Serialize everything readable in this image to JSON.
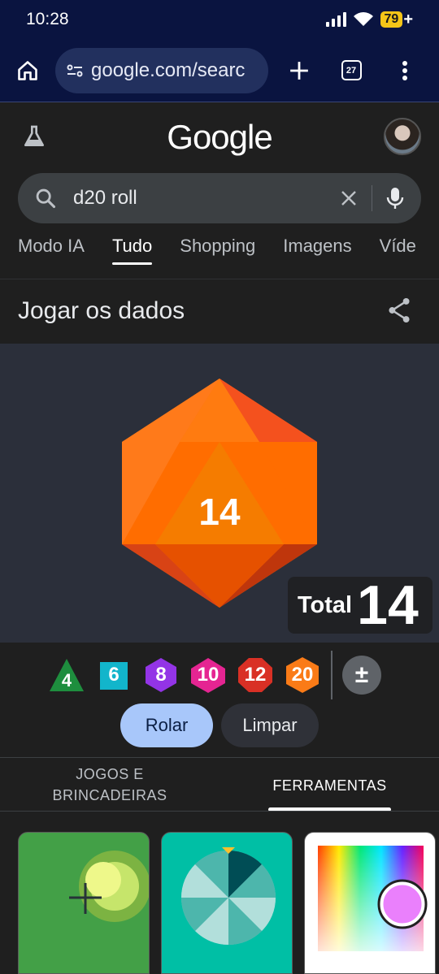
{
  "status": {
    "time": "10:28",
    "battery": "79"
  },
  "browser": {
    "url": "google.com/searc",
    "tab_count": "27"
  },
  "google": {
    "logo": "Google"
  },
  "search": {
    "query": "d20 roll"
  },
  "nav_tabs": [
    "Modo IA",
    "Tudo",
    "Shopping",
    "Imagens",
    "Víde"
  ],
  "dice_card": {
    "title": "Jogar os dados",
    "die_face": "14",
    "total_label": "Total",
    "total_value": "14"
  },
  "dice_options": [
    {
      "label": "4",
      "color": "#1e8e3e"
    },
    {
      "label": "6",
      "color": "#12b5cb"
    },
    {
      "label": "8",
      "color": "#9334e6"
    },
    {
      "label": "10",
      "color": "#e52592"
    },
    {
      "label": "12",
      "color": "#d93025"
    },
    {
      "label": "20",
      "color": "#fa7b17"
    }
  ],
  "modifier_label": "±",
  "buttons": {
    "roll": "Rolar",
    "clear": "Limpar"
  },
  "categories": {
    "games": "JOGOS E\nBRINCADEIRAS",
    "tools": "FERRAMENTAS"
  },
  "colors": {
    "accent": "#a8c7fa",
    "die": "#ff6d00",
    "background": "#1f1f1f"
  }
}
